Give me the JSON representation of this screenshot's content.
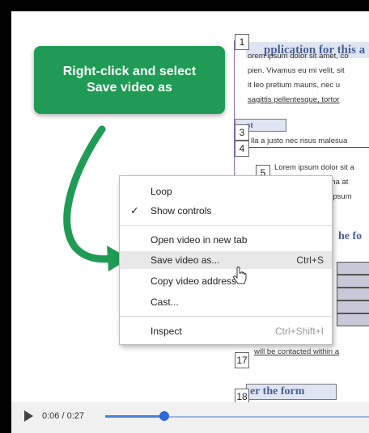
{
  "document": {
    "title": "pplication for this a",
    "lines": [
      "orem ipsum dolor sit amet, co",
      "pien. Vivamus eu mi velit, sit",
      "it leo pretium mauris, nec u",
      "sagittis pellentesque, tortor"
    ],
    "section_3": "st",
    "line_4": "lla a justo nec risus malesua",
    "sub_5_lines": [
      "Lorem ipsum dolor sit a",
      "gna at",
      "t ipsum"
    ],
    "hdr_2": "he fo",
    "contact_line": "will be contacted within a",
    "footer_heading": "er the form",
    "numbers": [
      "1",
      "3",
      "4",
      "5",
      "17",
      "18"
    ]
  },
  "callout": {
    "line1": "Right-click and select",
    "line2": "Save video as",
    "color": "#1f9b55"
  },
  "context_menu": {
    "items": [
      {
        "label": "Loop",
        "shortcut": "",
        "checked": false
      },
      {
        "label": "Show controls",
        "shortcut": "",
        "checked": true
      },
      {
        "label": "Open video in new tab",
        "shortcut": ""
      },
      {
        "label": "Save video as...",
        "shortcut": "Ctrl+S",
        "highlighted": true
      },
      {
        "label": "Copy video address",
        "shortcut": ""
      },
      {
        "label": "Cast...",
        "shortcut": ""
      },
      {
        "label": "Inspect",
        "shortcut": "Ctrl+Shift+I"
      }
    ],
    "check_glyph": "✓"
  },
  "player": {
    "time": "0:06 / 0:27",
    "progress_fraction": 0.22,
    "icon": "play-icon"
  }
}
